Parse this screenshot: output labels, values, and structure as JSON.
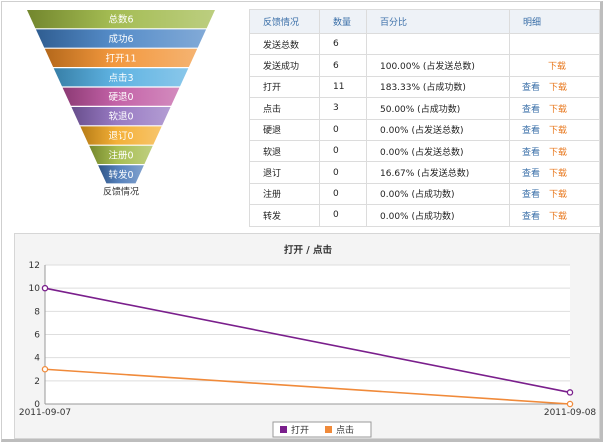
{
  "funnel": {
    "caption": "反馈情况",
    "levels": [
      {
        "label": "总数6",
        "color": "#98b33c"
      },
      {
        "label": "成功6",
        "color": "#3e7cc1"
      },
      {
        "label": "打开11",
        "color": "#f08a24"
      },
      {
        "label": "点击3",
        "color": "#49a9de"
      },
      {
        "label": "硬退0",
        "color": "#bb4d9b"
      },
      {
        "label": "软退0",
        "color": "#8a68bb"
      },
      {
        "label": "退订0",
        "color": "#f3a51d"
      },
      {
        "label": "注册0",
        "color": "#9cb53c"
      },
      {
        "label": "转发0",
        "color": "#3e70b3"
      }
    ]
  },
  "table": {
    "headers": [
      "反馈情况",
      "数量",
      "百分比",
      "明细"
    ],
    "view_label": "查看",
    "download_label": "下载",
    "rows": [
      {
        "name": "发送总数",
        "count": "6",
        "percent": "",
        "view": false,
        "download": false
      },
      {
        "name": "发送成功",
        "count": "6",
        "percent": "100.00% (占发送总数)",
        "view": false,
        "download": true
      },
      {
        "name": "打开",
        "count": "11",
        "percent": "183.33% (占成功数)",
        "view": true,
        "download": true
      },
      {
        "name": "点击",
        "count": "3",
        "percent": "50.00% (占成功数)",
        "view": true,
        "download": true
      },
      {
        "name": "硬退",
        "count": "0",
        "percent": "0.00% (占发送总数)",
        "view": true,
        "download": true
      },
      {
        "name": "软退",
        "count": "0",
        "percent": "0.00% (占发送总数)",
        "view": true,
        "download": true
      },
      {
        "name": "退订",
        "count": "0",
        "percent": "16.67% (占发送总数)",
        "view": true,
        "download": true
      },
      {
        "name": "注册",
        "count": "0",
        "percent": "0.00% (占成功数)",
        "view": true,
        "download": true
      },
      {
        "name": "转发",
        "count": "0",
        "percent": "0.00% (占成功数)",
        "view": true,
        "download": true
      }
    ]
  },
  "chart_data": {
    "type": "line",
    "title": "打开 / 点击",
    "xlabel": "",
    "ylabel": "",
    "x": [
      "2011-09-07",
      "2011-09-08"
    ],
    "ylim": [
      0,
      12
    ],
    "yticks": [
      0,
      2,
      4,
      6,
      8,
      10,
      12
    ],
    "grid": true,
    "legend": "bottom-center",
    "series": [
      {
        "name": "打开",
        "values": [
          10,
          1
        ],
        "color": "#7a1f8c"
      },
      {
        "name": "点击",
        "values": [
          3,
          0
        ],
        "color": "#f08a3a"
      }
    ]
  }
}
